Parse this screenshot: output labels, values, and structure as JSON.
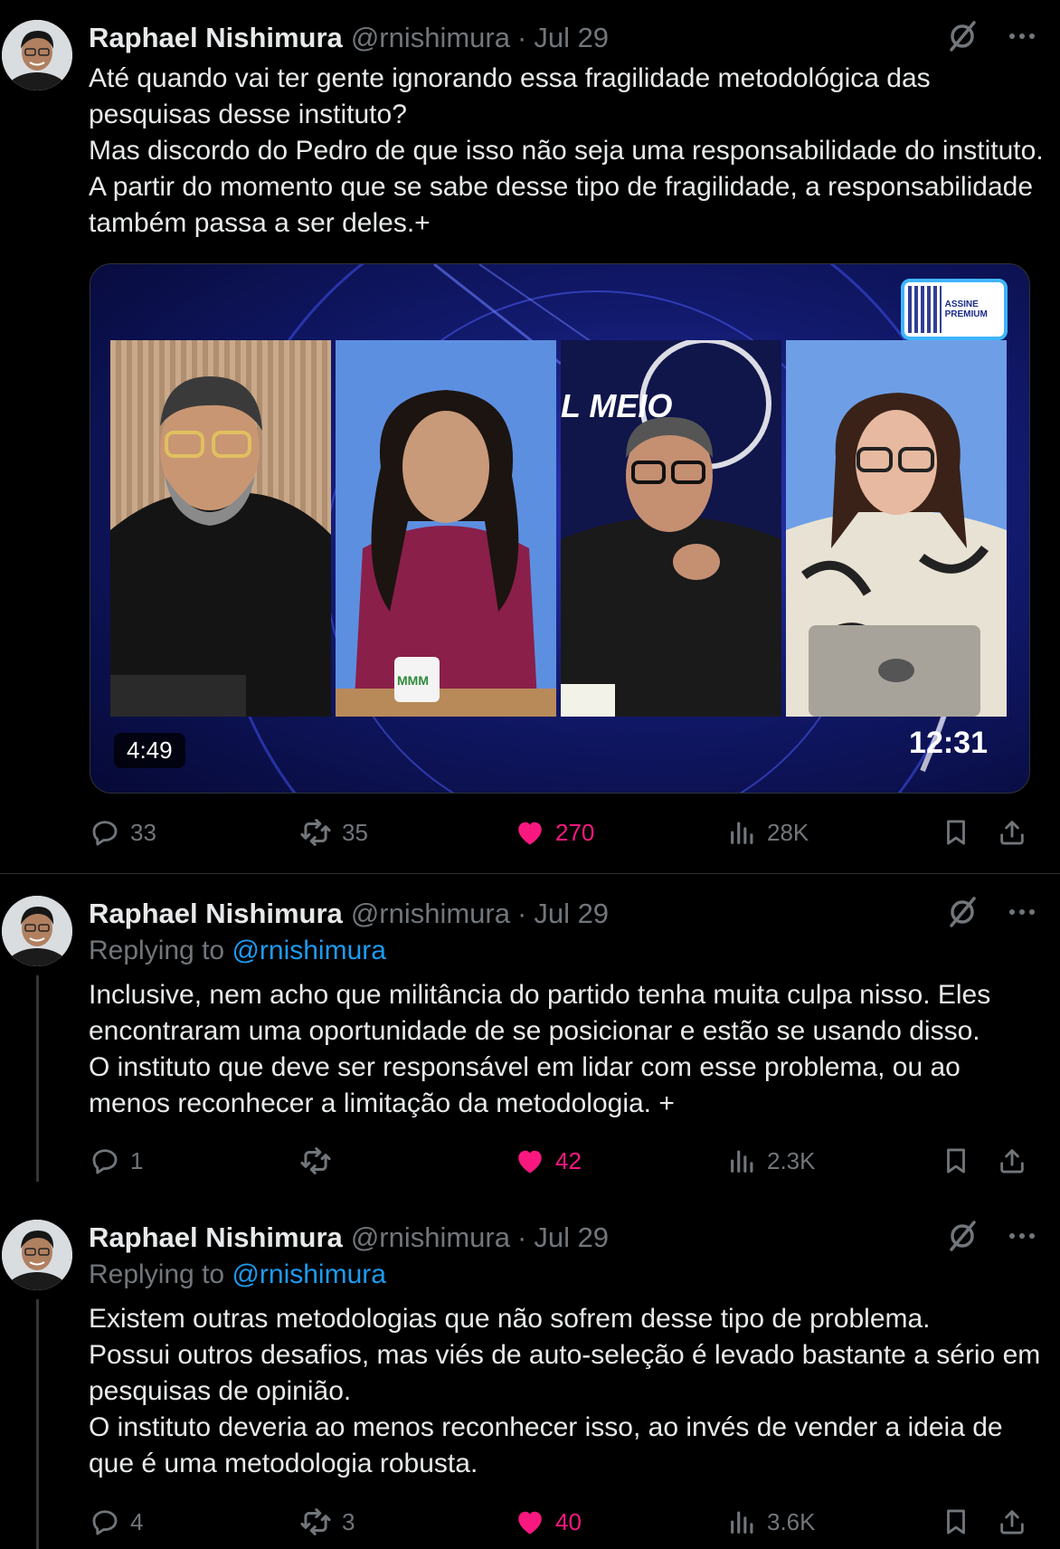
{
  "tweets": [
    {
      "name": "Raphael Nishimura",
      "handle": "@rnishimura",
      "separator": "·",
      "date": "Jul 29",
      "lines": [
        "Até quando vai ter gente ignorando essa fragilidade metodológica das pesquisas desse instituto?",
        "Mas discordo do Pedro de que isso não seja uma responsabilidade do instituto. A partir do momento que se sabe desse tipo de fragilidade, a responsabilidade também passa a ser deles.+"
      ],
      "media": {
        "duration": "4:49",
        "clock": "12:31",
        "badge_text": "ASSINE PREMIUM",
        "studio_sign": "L MEIO",
        "mug_logo": "MMM"
      },
      "stats": {
        "replies": "33",
        "reposts": "35",
        "likes": "270",
        "views": "28K"
      }
    },
    {
      "name": "Raphael Nishimura",
      "handle": "@rnishimura",
      "separator": "·",
      "date": "Jul 29",
      "replying_label": "Replying to",
      "replying_to": "@rnishimura",
      "lines": [
        "Inclusive, nem acho que militância do partido tenha muita culpa nisso. Eles encontraram uma oportunidade de se posicionar e estão se usando disso.",
        "O instituto que deve ser responsável em lidar com esse problema, ou ao menos reconhecer a limitação da metodologia. +"
      ],
      "stats": {
        "replies": "1",
        "reposts": "",
        "likes": "42",
        "views": "2.3K"
      }
    },
    {
      "name": "Raphael Nishimura",
      "handle": "@rnishimura",
      "separator": "·",
      "date": "Jul 29",
      "replying_label": "Replying to",
      "replying_to": "@rnishimura",
      "lines": [
        "Existem outras metodologias que não sofrem desse tipo de problema.",
        "Possui outros desafios, mas viés de auto-seleção é levado bastante a sério em pesquisas de opinião.",
        "O instituto deveria ao menos reconhecer isso, ao invés de vender a ideia de que é uma metodologia robusta."
      ],
      "stats": {
        "replies": "4",
        "reposts": "3",
        "likes": "40",
        "views": "3.6K"
      }
    }
  ],
  "icons": {
    "grok": "grok-icon",
    "more": "more-icon",
    "reply": "reply-icon",
    "repost": "repost-icon",
    "like": "heart-icon",
    "views": "views-icon",
    "bookmark": "bookmark-icon",
    "share": "share-icon"
  },
  "colors": {
    "background": "#000000",
    "text": "#e7e9ea",
    "secondary": "#71767b",
    "mention": "#1d9bf0",
    "like": "#f91880"
  }
}
